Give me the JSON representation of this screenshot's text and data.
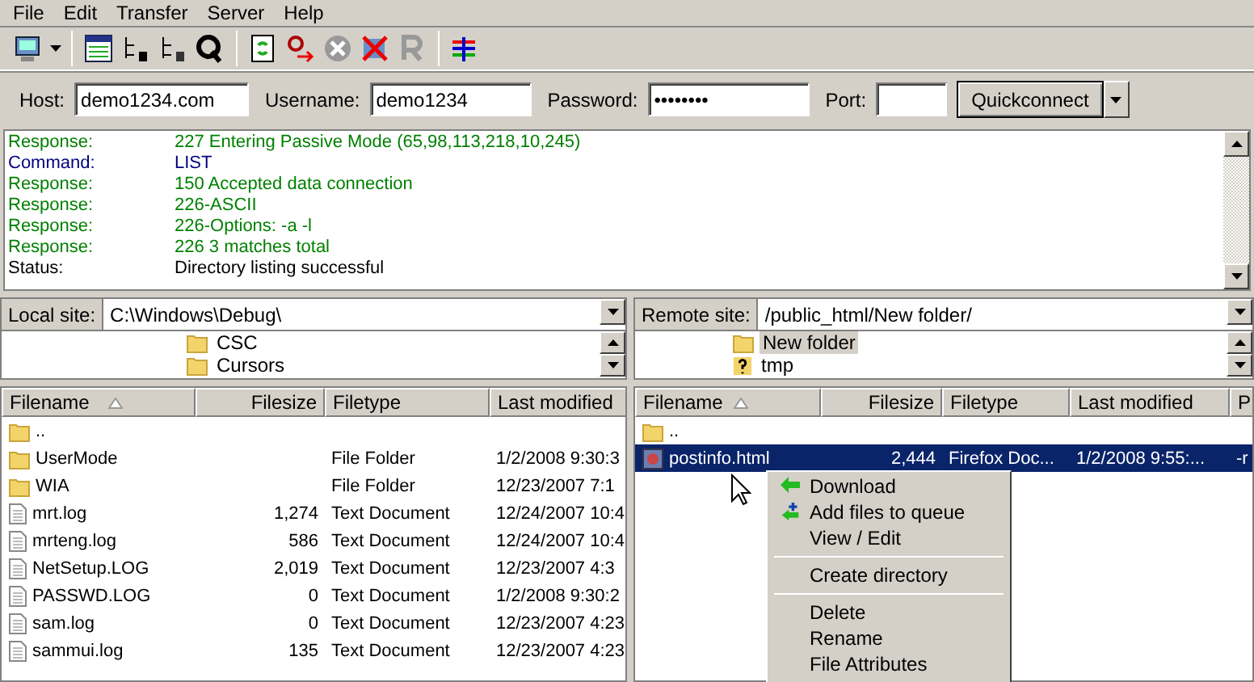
{
  "menu": [
    "File",
    "Edit",
    "Transfer",
    "Server",
    "Help"
  ],
  "quickconnect": {
    "host_label": "Host:",
    "host": "demo1234.com",
    "username_label": "Username:",
    "username": "demo1234",
    "password_label": "Password:",
    "password": "••••••••",
    "port_label": "Port:",
    "button": "Quickconnect"
  },
  "log": [
    {
      "kind": "response",
      "label": "Response:",
      "text": "227 Entering Passive Mode (65,98,113,218,10,245)"
    },
    {
      "kind": "command",
      "label": "Command:",
      "text": "LIST"
    },
    {
      "kind": "response",
      "label": "Response:",
      "text": "150 Accepted data connection"
    },
    {
      "kind": "response",
      "label": "Response:",
      "text": "226-ASCII"
    },
    {
      "kind": "response",
      "label": "Response:",
      "text": "226-Options: -a -l"
    },
    {
      "kind": "response",
      "label": "Response:",
      "text": "226 3 matches total"
    },
    {
      "kind": "status",
      "label": "Status:",
      "text": "Directory listing successful"
    }
  ],
  "local": {
    "site_label": "Local site:",
    "path": "C:\\Windows\\Debug\\",
    "tree": [
      {
        "kind": "folder",
        "name": "CSC",
        "selected": false
      },
      {
        "kind": "folder",
        "name": "Cursors",
        "selected": false
      }
    ],
    "columns": [
      "Filename",
      "Filesize",
      "Filetype",
      "Last modified"
    ],
    "rows": [
      {
        "kind": "folder",
        "selected": false,
        "cells": [
          ".."
        ]
      },
      {
        "kind": "folder",
        "selected": false,
        "cells": [
          "UserMode",
          "",
          "File Folder",
          "1/2/2008 9:30:3"
        ]
      },
      {
        "kind": "folder",
        "selected": false,
        "cells": [
          "WIA",
          "",
          "File Folder",
          "12/23/2007 7:1"
        ]
      },
      {
        "kind": "file",
        "selected": false,
        "cells": [
          "mrt.log",
          "1,274",
          "Text Document",
          "12/24/2007 10:4"
        ]
      },
      {
        "kind": "file",
        "selected": false,
        "cells": [
          "mrteng.log",
          "586",
          "Text Document",
          "12/24/2007 10:4"
        ]
      },
      {
        "kind": "file",
        "selected": false,
        "cells": [
          "NetSetup.LOG",
          "2,019",
          "Text Document",
          "12/23/2007 4:3"
        ]
      },
      {
        "kind": "file",
        "selected": false,
        "cells": [
          "PASSWD.LOG",
          "0",
          "Text Document",
          "1/2/2008 9:30:2"
        ]
      },
      {
        "kind": "file",
        "selected": false,
        "cells": [
          "sam.log",
          "0",
          "Text Document",
          "12/23/2007 4:23"
        ]
      },
      {
        "kind": "file",
        "selected": false,
        "cells": [
          "sammui.log",
          "135",
          "Text Document",
          "12/23/2007 4:23"
        ]
      }
    ]
  },
  "remote": {
    "site_label": "Remote site:",
    "path": "/public_html/New folder/",
    "tree": [
      {
        "kind": "folder",
        "name": "New folder",
        "selected": true
      },
      {
        "kind": "unknown",
        "name": "tmp",
        "selected": false
      }
    ],
    "columns": [
      "Filename",
      "Filesize",
      "Filetype",
      "Last modified",
      "P"
    ],
    "rows": [
      {
        "kind": "folder",
        "selected": false,
        "cells": [
          ".."
        ]
      },
      {
        "kind": "web",
        "selected": true,
        "cells": [
          "postinfo.html",
          "2,444",
          "Firefox Doc...",
          "1/2/2008 9:55:...",
          "-r"
        ]
      }
    ]
  },
  "context_menu": [
    {
      "kind": "item",
      "label": "Download"
    },
    {
      "kind": "item",
      "label": "Add files to queue"
    },
    {
      "kind": "item",
      "label": "View / Edit"
    },
    {
      "kind": "separator"
    },
    {
      "kind": "item",
      "label": "Create directory"
    },
    {
      "kind": "separator"
    },
    {
      "kind": "item",
      "label": "Delete"
    },
    {
      "kind": "item",
      "label": "Rename"
    },
    {
      "kind": "item",
      "label": "File Attributes"
    }
  ]
}
